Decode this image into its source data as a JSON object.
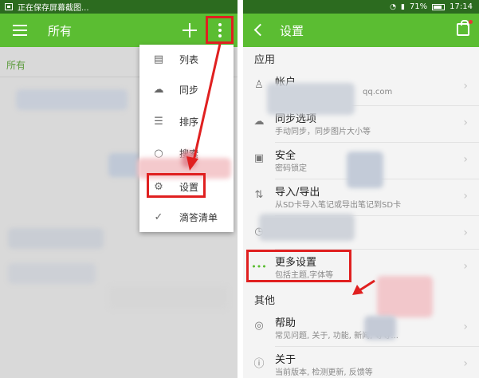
{
  "left": {
    "status_text": "正在保存屏幕截图...",
    "toolbar_title": "所有",
    "filter_label": "所有",
    "menu": [
      {
        "label": "列表",
        "icon": "list-icon"
      },
      {
        "label": "同步",
        "icon": "cloud-sync-icon"
      },
      {
        "label": "排序",
        "icon": "sort-icon"
      },
      {
        "label": "搜索",
        "icon": "search-icon"
      },
      {
        "label": "设置",
        "icon": "gear-icon"
      },
      {
        "label": "滴答清单",
        "icon": "checkmark-icon"
      }
    ]
  },
  "right": {
    "status_battery": "71%",
    "status_time": "17:14",
    "toolbar_title": "设置",
    "sections": [
      {
        "header": "应用",
        "items": [
          {
            "title": "帐户",
            "subtitle": "qq.com",
            "icon": "user-icon"
          },
          {
            "title": "同步选项",
            "subtitle": "手动同步，同步图片大小等",
            "icon": "cloud-icon"
          },
          {
            "title": "安全",
            "subtitle": "密码锁定",
            "icon": "lock-icon"
          },
          {
            "title": "导入/导出",
            "subtitle": "从SD卡导入笔记或导出笔记到SD卡",
            "icon": "import-export-icon"
          },
          {
            "title": "提醒",
            "subtitle": "",
            "icon": "alarm-icon"
          },
          {
            "title": "更多设置",
            "subtitle": "包括主题,字体等",
            "icon": "more-dots-icon"
          }
        ]
      },
      {
        "header": "其他",
        "items": [
          {
            "title": "帮助",
            "subtitle": "常见问题, 关于, 功能, 新闻, 等等...",
            "icon": "help-icon"
          },
          {
            "title": "关于",
            "subtitle": "当前版本, 检测更新, 反馈等",
            "icon": "info-icon"
          }
        ]
      }
    ]
  },
  "colors": {
    "toolbar_green": "#5bbd32",
    "status_dark_green": "#2c6b1f",
    "highlight_red": "#e02020"
  }
}
